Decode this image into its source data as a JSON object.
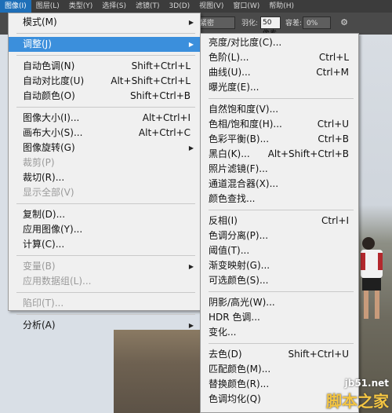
{
  "menubar": {
    "items": [
      "图像(I)",
      "图层(L)",
      "类型(Y)",
      "选择(S)",
      "滤镜(T)",
      "3D(D)",
      "视图(V)",
      "窗口(W)",
      "帮助(H)"
    ],
    "active_index": 0
  },
  "options": {
    "style_select": "紧密",
    "feather_label": "羽化:",
    "feather_value": "50 像素",
    "tolerance_label": "容差:",
    "tolerance_value": "0%"
  },
  "main_menu": [
    {
      "label": "模式(M)",
      "shortcut": "",
      "submenu": true,
      "disabled": false
    },
    {
      "sep": true
    },
    {
      "label": "调整(J)",
      "shortcut": "",
      "submenu": true,
      "disabled": false,
      "highlight": true
    },
    {
      "sep": true
    },
    {
      "label": "自动色调(N)",
      "shortcut": "Shift+Ctrl+L"
    },
    {
      "label": "自动对比度(U)",
      "shortcut": "Alt+Shift+Ctrl+L"
    },
    {
      "label": "自动颜色(O)",
      "shortcut": "Shift+Ctrl+B"
    },
    {
      "sep": true
    },
    {
      "label": "图像大小(I)...",
      "shortcut": "Alt+Ctrl+I"
    },
    {
      "label": "画布大小(S)...",
      "shortcut": "Alt+Ctrl+C"
    },
    {
      "label": "图像旋转(G)",
      "shortcut": "",
      "submenu": true
    },
    {
      "label": "裁剪(P)",
      "shortcut": "",
      "disabled": true
    },
    {
      "label": "裁切(R)...",
      "shortcut": ""
    },
    {
      "label": "显示全部(V)",
      "shortcut": "",
      "disabled": true
    },
    {
      "sep": true
    },
    {
      "label": "复制(D)...",
      "shortcut": ""
    },
    {
      "label": "应用图像(Y)...",
      "shortcut": ""
    },
    {
      "label": "计算(C)...",
      "shortcut": ""
    },
    {
      "sep": true
    },
    {
      "label": "变量(B)",
      "shortcut": "",
      "submenu": true,
      "disabled": true
    },
    {
      "label": "应用数据组(L)...",
      "shortcut": "",
      "disabled": true
    },
    {
      "sep": true
    },
    {
      "label": "陷印(T)...",
      "shortcut": "",
      "disabled": true
    },
    {
      "sep": true
    },
    {
      "label": "分析(A)",
      "shortcut": "",
      "submenu": true
    }
  ],
  "sub_menu": [
    {
      "label": "亮度/对比度(C)...",
      "shortcut": ""
    },
    {
      "label": "色阶(L)...",
      "shortcut": "Ctrl+L"
    },
    {
      "label": "曲线(U)...",
      "shortcut": "Ctrl+M"
    },
    {
      "label": "曝光度(E)...",
      "shortcut": ""
    },
    {
      "sep": true
    },
    {
      "label": "自然饱和度(V)...",
      "shortcut": ""
    },
    {
      "label": "色相/饱和度(H)...",
      "shortcut": "Ctrl+U"
    },
    {
      "label": "色彩平衡(B)...",
      "shortcut": "Ctrl+B"
    },
    {
      "label": "黑白(K)...",
      "shortcut": "Alt+Shift+Ctrl+B"
    },
    {
      "label": "照片滤镜(F)...",
      "shortcut": ""
    },
    {
      "label": "通道混合器(X)...",
      "shortcut": ""
    },
    {
      "label": "颜色查找...",
      "shortcut": ""
    },
    {
      "sep": true
    },
    {
      "label": "反相(I)",
      "shortcut": "Ctrl+I"
    },
    {
      "label": "色调分离(P)...",
      "shortcut": ""
    },
    {
      "label": "阈值(T)...",
      "shortcut": ""
    },
    {
      "label": "渐变映射(G)...",
      "shortcut": ""
    },
    {
      "label": "可选颜色(S)...",
      "shortcut": ""
    },
    {
      "sep": true
    },
    {
      "label": "阴影/高光(W)...",
      "shortcut": ""
    },
    {
      "label": "HDR 色调...",
      "shortcut": ""
    },
    {
      "label": "变化...",
      "shortcut": ""
    },
    {
      "sep": true
    },
    {
      "label": "去色(D)",
      "shortcut": "Shift+Ctrl+U"
    },
    {
      "label": "匹配颜色(M)...",
      "shortcut": ""
    },
    {
      "label": "替换颜色(R)...",
      "shortcut": ""
    },
    {
      "label": "色调均化(Q)",
      "shortcut": ""
    }
  ],
  "watermark": {
    "line1": "jb51.net",
    "line2": "脚本之家"
  },
  "colors": {
    "highlight": "#3b8fdc",
    "menu_bg": "#f0f0f0",
    "menubar_bg": "#3c3c3c"
  }
}
